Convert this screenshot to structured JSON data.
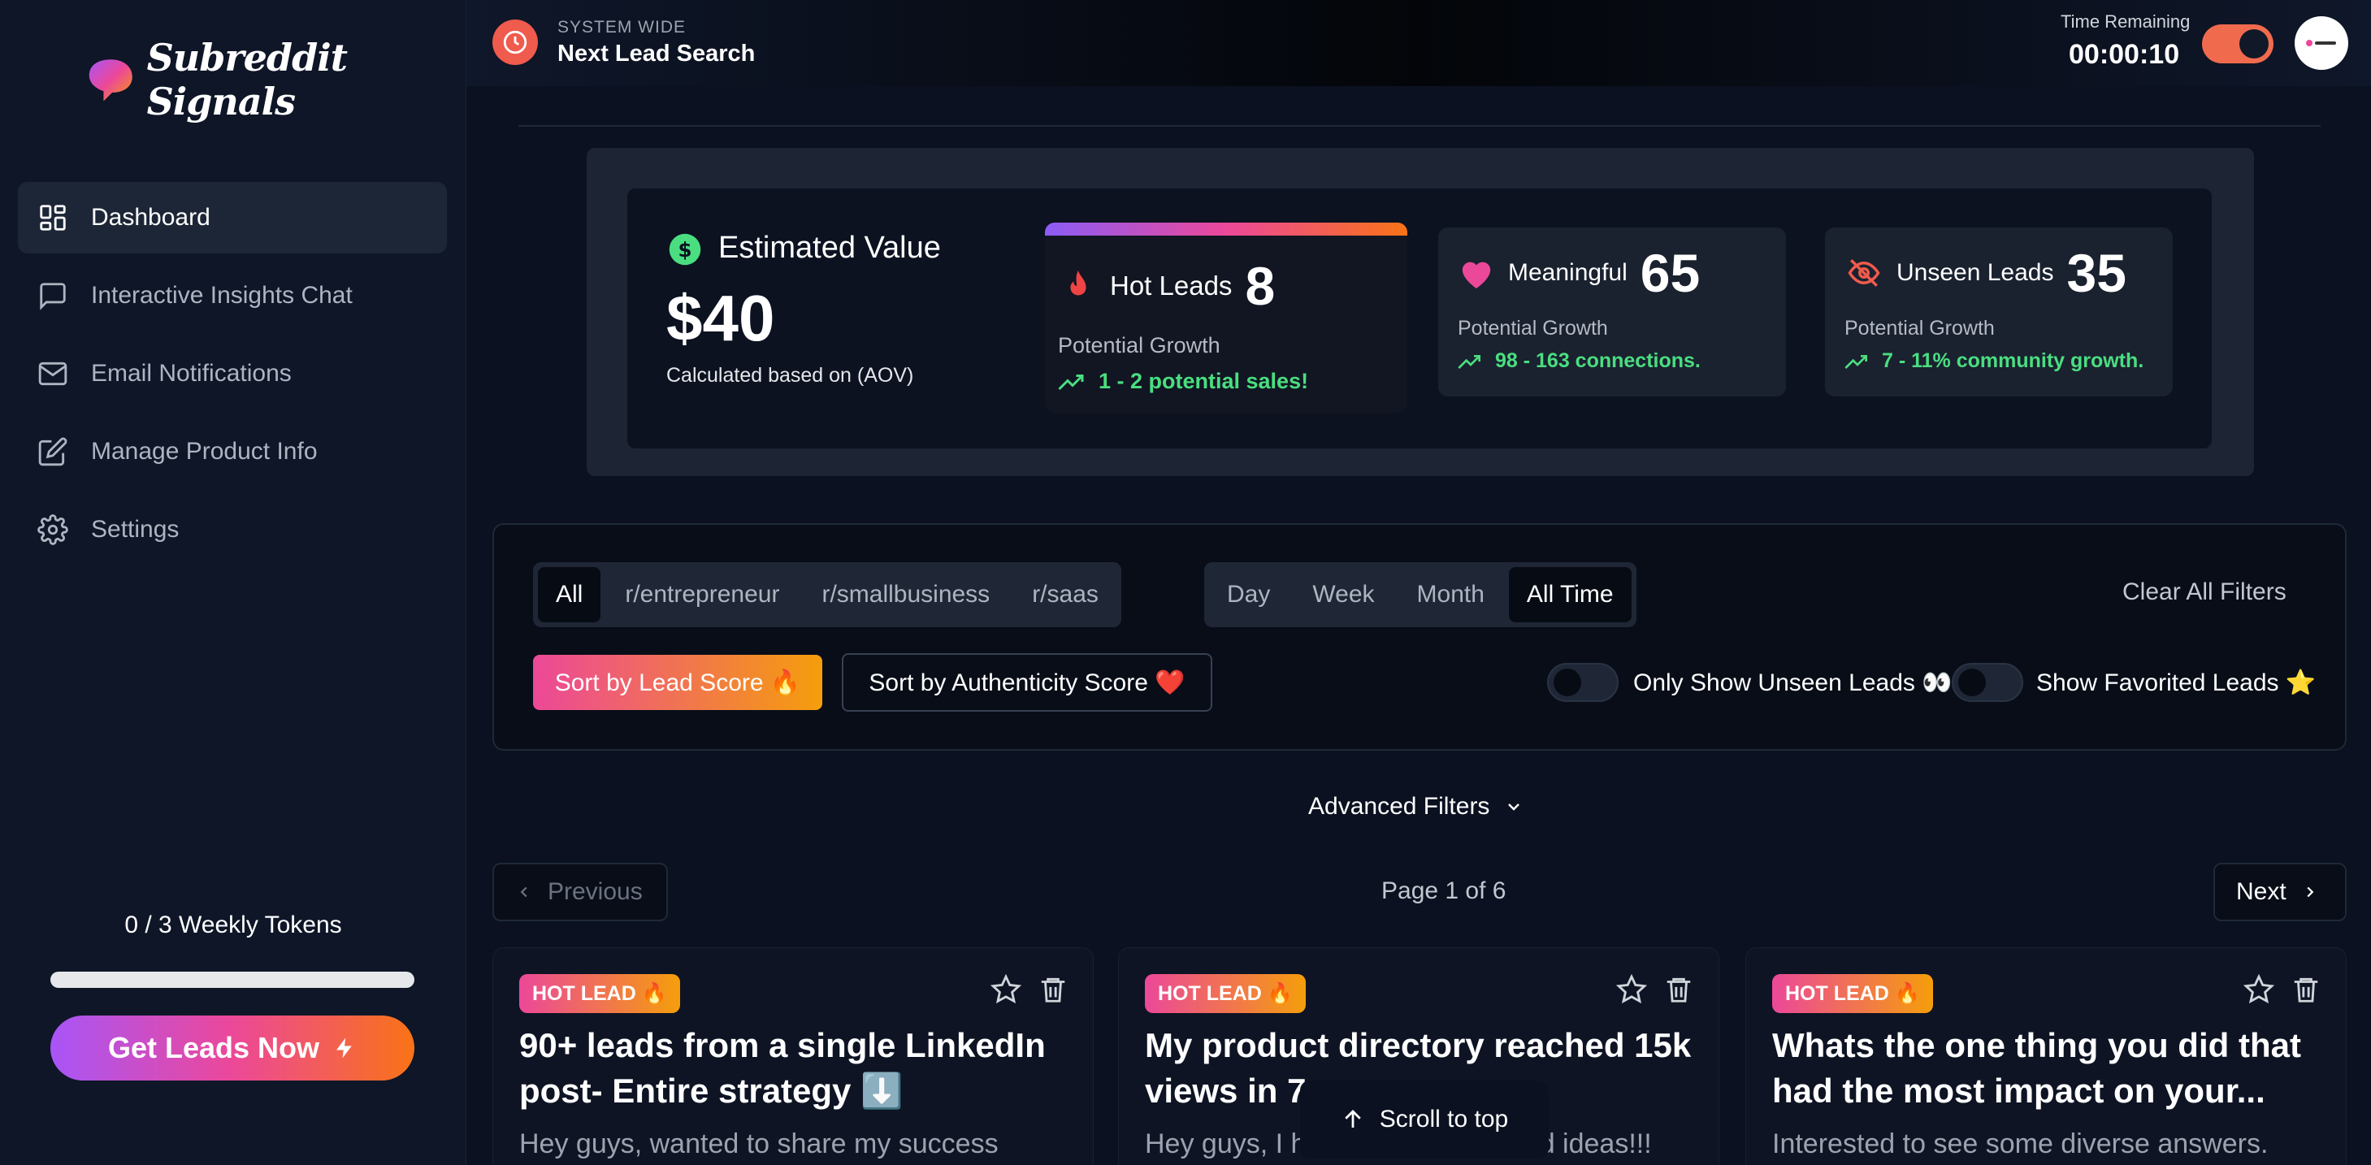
{
  "app": {
    "name": "Subreddit Signals"
  },
  "sidebar": {
    "items": [
      {
        "label": "Dashboard",
        "icon": "dashboard-icon",
        "active": true
      },
      {
        "label": "Interactive Insights Chat",
        "icon": "chat-icon",
        "active": false
      },
      {
        "label": "Email Notifications",
        "icon": "mail-icon",
        "active": false
      },
      {
        "label": "Manage Product Info",
        "icon": "edit-icon",
        "active": false
      },
      {
        "label": "Settings",
        "icon": "gear-icon",
        "active": false
      }
    ],
    "tokens_label": "0 / 3 Weekly Tokens",
    "tokens_used": 0,
    "tokens_total": 3,
    "cta_label": "Get Leads Now"
  },
  "header": {
    "system_label": "SYSTEM WIDE",
    "title": "Next Lead Search",
    "time_label": "Time Remaining",
    "time_value": "00:00:10",
    "toggle_on": true
  },
  "stats": {
    "estimated": {
      "title": "Estimated Value",
      "value": "$40",
      "sub": "Calculated based on (AOV)"
    },
    "hot": {
      "title": "Hot Leads",
      "count": "8",
      "growth_label": "Potential Growth",
      "growth_value": "1 - 2 potential sales!"
    },
    "meaningful": {
      "title": "Meaningful",
      "count": "65",
      "growth_label": "Potential Growth",
      "growth_value": "98 - 163 connections."
    },
    "unseen": {
      "title": "Unseen Leads",
      "count": "35",
      "growth_label": "Potential Growth",
      "growth_value": "7 - 11% community growth."
    }
  },
  "filters": {
    "subreddits": [
      "All",
      "r/entrepreneur",
      "r/smallbusiness",
      "r/saas"
    ],
    "subreddit_active": "All",
    "time_ranges": [
      "Day",
      "Week",
      "Month",
      "All Time"
    ],
    "time_active": "All Time",
    "clear_label": "Clear All Filters",
    "sort_lead": "Sort by Lead Score 🔥",
    "sort_auth": "Sort by Authenticity Score ❤️",
    "unseen_toggle": "Only Show Unseen Leads 👀",
    "favorites_toggle": "Show Favorited Leads ⭐",
    "advanced": "Advanced Filters"
  },
  "pagination": {
    "prev": "Previous",
    "next": "Next",
    "info": "Page 1 of 6"
  },
  "leads": [
    {
      "badge": "HOT LEAD 🔥",
      "title": "90+ leads from a single LinkedIn post- Entire strategy ⬇️",
      "body": "Hey guys, wanted to share my success"
    },
    {
      "badge": "HOT LEAD 🔥",
      "title": "My product directory reached 15k views in 7",
      "body": "Hey guys, I have a lot of time and ideas!!!"
    },
    {
      "badge": "HOT LEAD 🔥",
      "title": "Whats the one thing you did that had the most impact on your...",
      "body": "Interested to see some diverse answers."
    }
  ],
  "scroll_top": "Scroll to top",
  "colors": {
    "accent_green": "#4ade80",
    "hot_gradient_start": "#ec4899",
    "hot_gradient_end": "#f59e0b",
    "orange": "#f06b4e"
  }
}
